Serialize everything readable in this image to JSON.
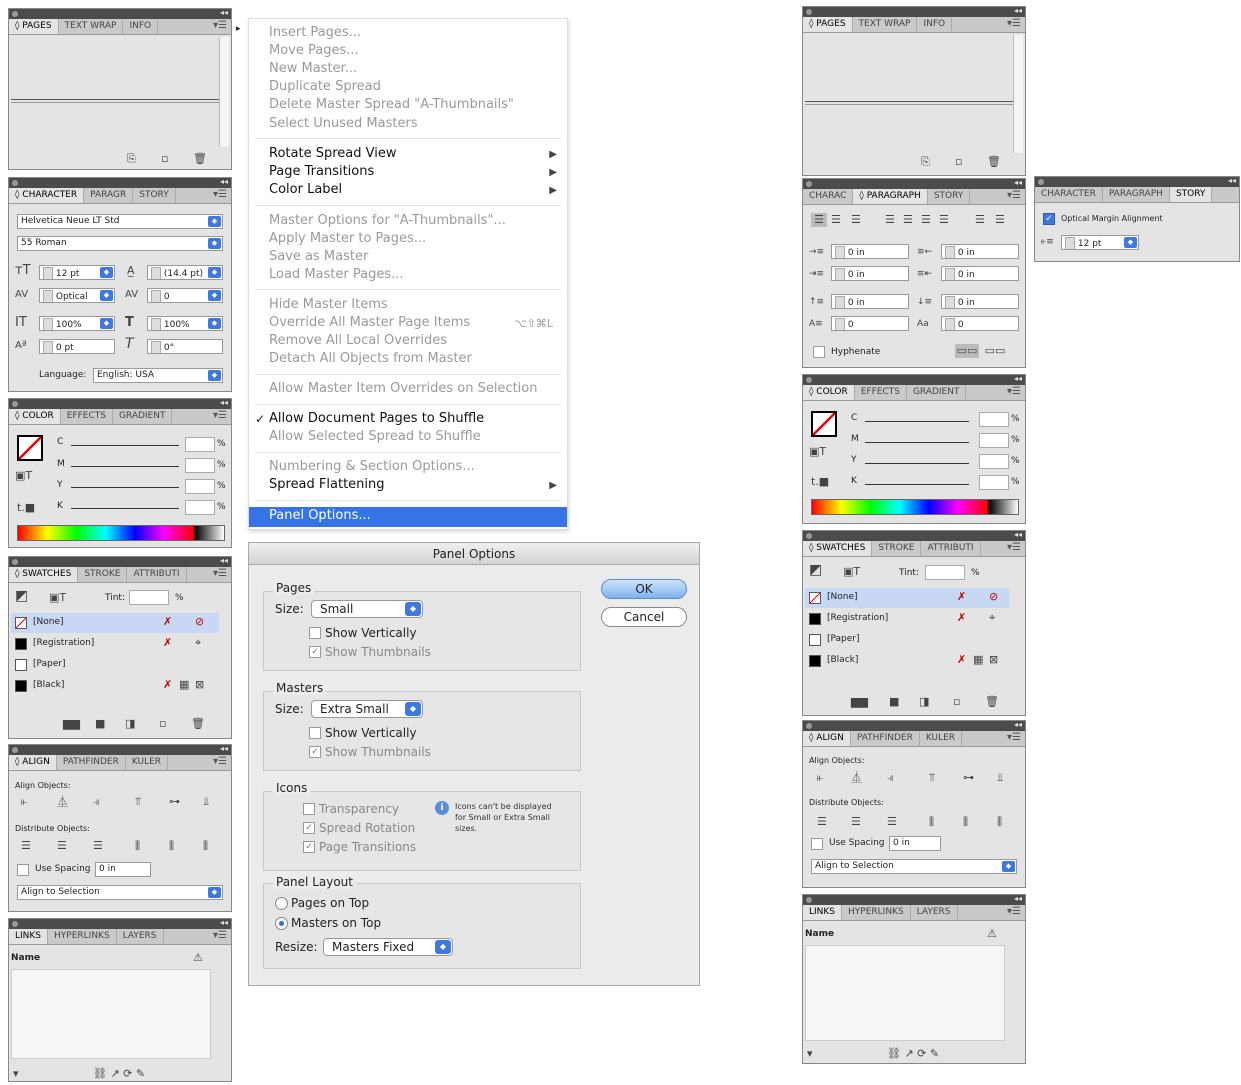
{
  "pages_panel": {
    "tabs": [
      "◊ PAGES",
      "TEXT WRAP",
      "INFO"
    ]
  },
  "character_panel": {
    "tabs": [
      "◊ CHARACTER",
      "PARAGR",
      "STORY"
    ],
    "font_family": "Helvetica Neue LT Std",
    "font_style": "55 Roman",
    "size": "12 pt",
    "leading": "(14.4 pt)",
    "kerning": "Optical",
    "tracking": "0",
    "vscale": "100%",
    "hscale": "100%",
    "baseline": "0 pt",
    "skew": "0°",
    "language_label": "Language:",
    "language": "English: USA"
  },
  "color_panel": {
    "tabs": [
      "◊ COLOR",
      "EFFECTS",
      "GRADIENT"
    ],
    "channels": [
      "C",
      "M",
      "Y",
      "K"
    ],
    "pct": "%"
  },
  "swatches_panel": {
    "tabs": [
      "◊ SWATCHES",
      "STROKE",
      "ATTRIBUTI"
    ],
    "tint_label": "Tint:",
    "pct": "%",
    "rows": [
      "[None]",
      "[Registration]",
      "[Paper]",
      "[Black]"
    ]
  },
  "align_panel": {
    "tabs": [
      "◊ ALIGN",
      "PATHFINDER",
      "KULER"
    ],
    "align_objects": "Align Objects:",
    "distribute_objects": "Distribute Objects:",
    "use_spacing": "Use Spacing",
    "spacing": "0 in",
    "align_to": "Align to Selection"
  },
  "links_panel": {
    "tabs": [
      "LINKS",
      "HYPERLINKS",
      "LAYERS"
    ],
    "name_col": "Name"
  },
  "context_menu": {
    "items": [
      {
        "label": "Insert Pages...",
        "enabled": false
      },
      {
        "label": "Move Pages...",
        "enabled": false
      },
      {
        "label": "New Master...",
        "enabled": false
      },
      {
        "label": "Duplicate Spread",
        "enabled": false
      },
      {
        "label": "Delete Master Spread \"A-Thumbnails\"",
        "enabled": false
      },
      {
        "label": "Select Unused Masters",
        "enabled": false
      },
      {
        "label": "Rotate Spread View",
        "enabled": true,
        "submenu": true
      },
      {
        "label": "Page Transitions",
        "enabled": true,
        "submenu": true
      },
      {
        "label": "Color Label",
        "enabled": true,
        "submenu": true
      },
      {
        "label": "Master Options for \"A-Thumbnails\"...",
        "enabled": false
      },
      {
        "label": "Apply Master to Pages...",
        "enabled": false
      },
      {
        "label": "Save as Master",
        "enabled": false
      },
      {
        "label": "Load Master Pages...",
        "enabled": false
      },
      {
        "label": "Hide Master Items",
        "enabled": false
      },
      {
        "label": "Override All Master Page Items",
        "enabled": false,
        "shortcut": "⌥⇧⌘L"
      },
      {
        "label": "Remove All Local Overrides",
        "enabled": false
      },
      {
        "label": "Detach All Objects from Master",
        "enabled": false
      },
      {
        "label": "Allow Master Item Overrides on Selection",
        "enabled": false
      },
      {
        "label": "Allow Document Pages to Shuffle",
        "enabled": true,
        "checked": true
      },
      {
        "label": "Allow Selected Spread to Shuffle",
        "enabled": false
      },
      {
        "label": "Numbering & Section Options...",
        "enabled": false
      },
      {
        "label": "Spread Flattening",
        "enabled": true,
        "submenu": true
      },
      {
        "label": "Panel Options...",
        "enabled": true,
        "highlighted": true
      }
    ]
  },
  "panel_options": {
    "title": "Panel Options",
    "pages": {
      "title": "Pages",
      "size_label": "Size:",
      "size": "Small",
      "show_vertically": "Show Vertically",
      "show_thumbnails": "Show Thumbnails"
    },
    "masters": {
      "title": "Masters",
      "size_label": "Size:",
      "size": "Extra Small",
      "show_vertically": "Show Vertically",
      "show_thumbnails": "Show Thumbnails"
    },
    "icons": {
      "title": "Icons",
      "transparency": "Transparency",
      "spread_rotation": "Spread Rotation",
      "page_transitions": "Page Transitions",
      "note": "Icons can't be displayed for Small or Extra Small sizes."
    },
    "layout": {
      "title": "Panel Layout",
      "pages_on_top": "Pages on Top",
      "masters_on_top": "Masters on Top",
      "resize_label": "Resize:",
      "resize": "Masters Fixed"
    },
    "ok": "OK",
    "cancel": "Cancel"
  },
  "right_pages_panel": {
    "tabs": [
      "◊ PAGES",
      "TEXT WRAP",
      "INFO"
    ]
  },
  "paragraph_panel": {
    "tabs": [
      "CHARAC",
      "◊ PARAGRAPH",
      "STORY"
    ],
    "left_indent": "0 in",
    "right_indent": "0 in",
    "first_indent": "0 in",
    "last_indent": "0 in",
    "space_before": "0 in",
    "space_after": "0 in",
    "drop_lines": "0",
    "drop_chars": "0",
    "hyphenate": "Hyphenate"
  },
  "story_panel": {
    "tabs": [
      "CHARACTER",
      "PARAGRAPH",
      "STORY"
    ],
    "optical_margin": "Optical Margin Alignment",
    "size": "12 pt"
  },
  "right_color_panel": {
    "tabs": [
      "◊ COLOR",
      "EFFECTS",
      "GRADIENT"
    ],
    "channels": [
      "C",
      "M",
      "Y",
      "K"
    ],
    "pct": "%"
  },
  "right_swatches_panel": {
    "tabs": [
      "◊ SWATCHES",
      "STROKE",
      "ATTRIBUTI"
    ],
    "tint_label": "Tint:",
    "pct": "%",
    "rows": [
      "[None]",
      "[Registration]",
      "[Paper]",
      "[Black]"
    ]
  },
  "right_align_panel": {
    "tabs": [
      "◊ ALIGN",
      "PATHFINDER",
      "KULER"
    ],
    "align_objects": "Align Objects:",
    "distribute_objects": "Distribute Objects:",
    "use_spacing": "Use Spacing",
    "spacing": "0 in",
    "align_to": "Align to Selection"
  },
  "right_links_panel": {
    "tabs": [
      "LINKS",
      "HYPERLINKS",
      "LAYERS"
    ],
    "name_col": "Name"
  }
}
